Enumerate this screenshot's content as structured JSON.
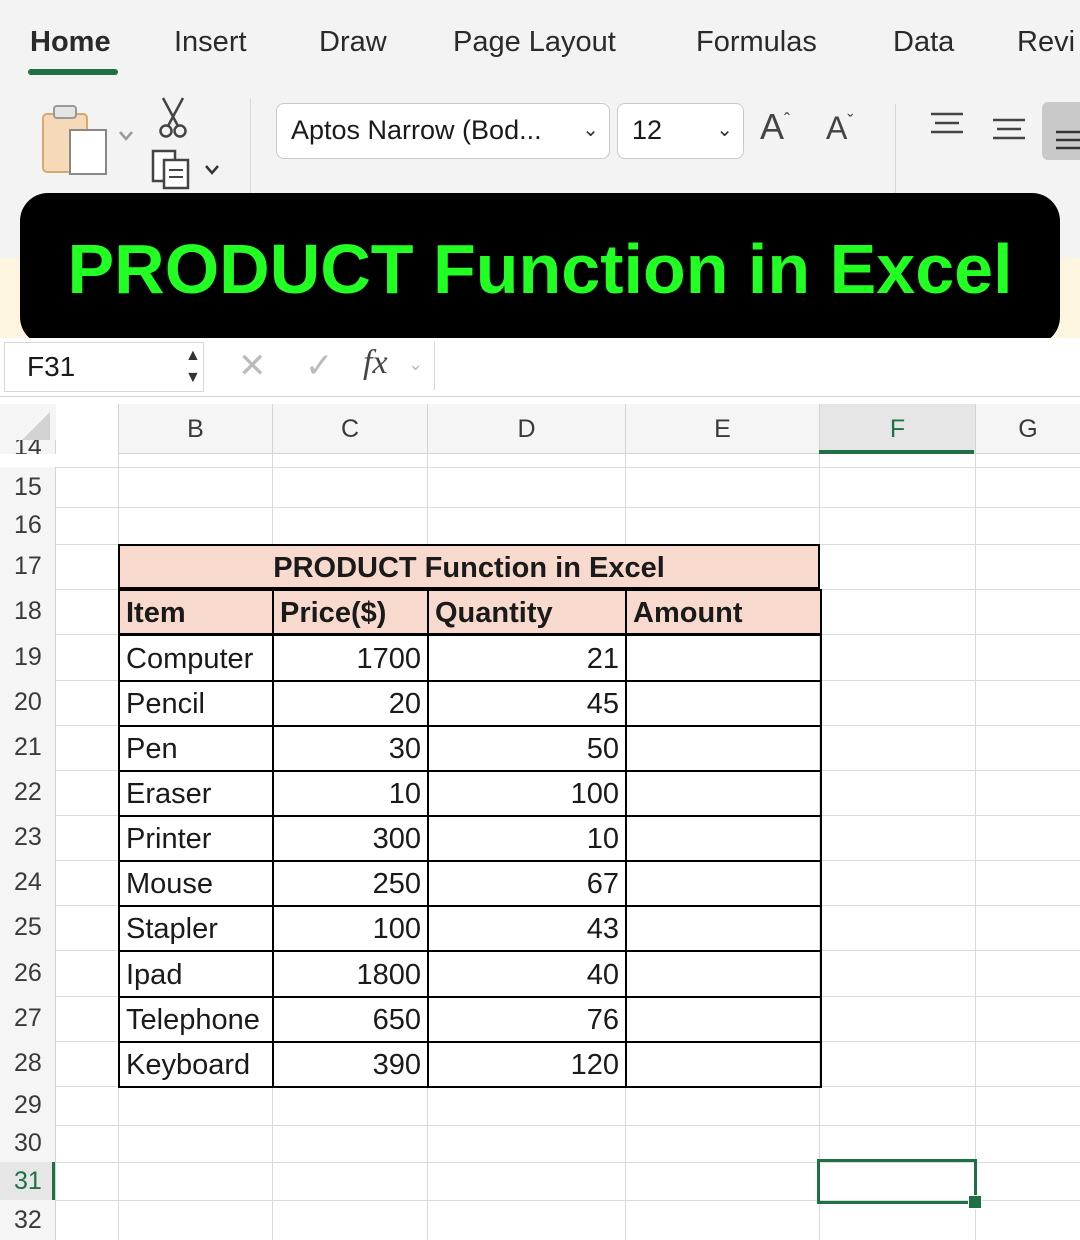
{
  "ribbon": {
    "tabs": [
      "Home",
      "Insert",
      "Draw",
      "Page Layout",
      "Formulas",
      "Data",
      "Revi"
    ],
    "font_name": "Aptos Narrow (Bod...",
    "font_size": "12",
    "grow_font": "A",
    "shrink_font": "A"
  },
  "banner": {
    "title": "PRODUCT Function in Excel"
  },
  "formula_bar": {
    "name_box": "F31",
    "cancel": "✕",
    "enter": "✓",
    "fx": "fx"
  },
  "columns": [
    "B",
    "C",
    "D",
    "E",
    "F",
    "G"
  ],
  "row_numbers": [
    "14",
    "15",
    "16",
    "17",
    "18",
    "19",
    "20",
    "21",
    "22",
    "23",
    "24",
    "25",
    "26",
    "27",
    "28",
    "29",
    "30",
    "31",
    "32"
  ],
  "table": {
    "title": "PRODUCT Function in Excel",
    "headers": [
      "Item",
      "Price($)",
      "Quantity",
      "Amount"
    ],
    "rows": [
      {
        "item": "Computer",
        "price": "1700",
        "quantity": "21",
        "amount": ""
      },
      {
        "item": "Pencil",
        "price": "20",
        "quantity": "45",
        "amount": ""
      },
      {
        "item": "Pen",
        "price": "30",
        "quantity": "50",
        "amount": ""
      },
      {
        "item": "Eraser",
        "price": "10",
        "quantity": "100",
        "amount": ""
      },
      {
        "item": "Printer",
        "price": "300",
        "quantity": "10",
        "amount": ""
      },
      {
        "item": "Mouse",
        "price": "250",
        "quantity": "67",
        "amount": ""
      },
      {
        "item": "Stapler",
        "price": "100",
        "quantity": "43",
        "amount": ""
      },
      {
        "item": "Ipad",
        "price": "1800",
        "quantity": "40",
        "amount": ""
      },
      {
        "item": "Telephone",
        "price": "650",
        "quantity": "76",
        "amount": ""
      },
      {
        "item": "Keyboard",
        "price": "390",
        "quantity": "120",
        "amount": ""
      }
    ]
  },
  "selection": {
    "active_cell": "F31",
    "active_column": "F",
    "active_row": "31"
  },
  "colors": {
    "accent": "#1e7145",
    "banner_text": "#22ff22",
    "header_fill": "#f8d9cd"
  },
  "icons": [
    "paste-icon",
    "cut-icon",
    "copy-icon",
    "grow-font-icon",
    "shrink-font-icon",
    "align-top-icon",
    "align-middle-icon",
    "align-bottom-icon"
  ]
}
